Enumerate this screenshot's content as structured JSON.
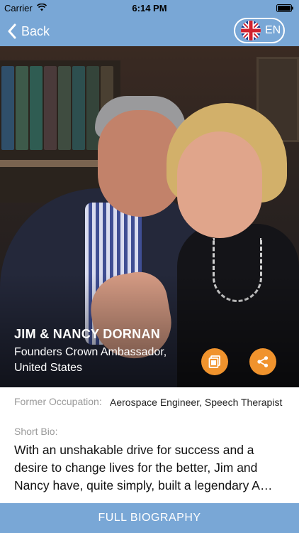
{
  "status_bar": {
    "carrier": "Carrier",
    "time": "6:14 PM"
  },
  "nav": {
    "back_label": "Back",
    "language_label": "EN"
  },
  "profile": {
    "name": "JIM & NANCY DORNAN",
    "title": "Founders Crown Ambassador, United States"
  },
  "details": {
    "occupation_label": "Former Occupation:",
    "occupation_value": "Aerospace Engineer, Speech Therapist",
    "bio_label": "Short Bio:",
    "bio_text": "With an unshakable drive for success and a desire to change lives for the better, Jim and Nancy have, quite simply, built a legendary A…"
  },
  "footer": {
    "full_bio_label": "FULL BIOGRAPHY"
  },
  "colors": {
    "bar": "#79a7d6",
    "accent": "#f0932d"
  }
}
